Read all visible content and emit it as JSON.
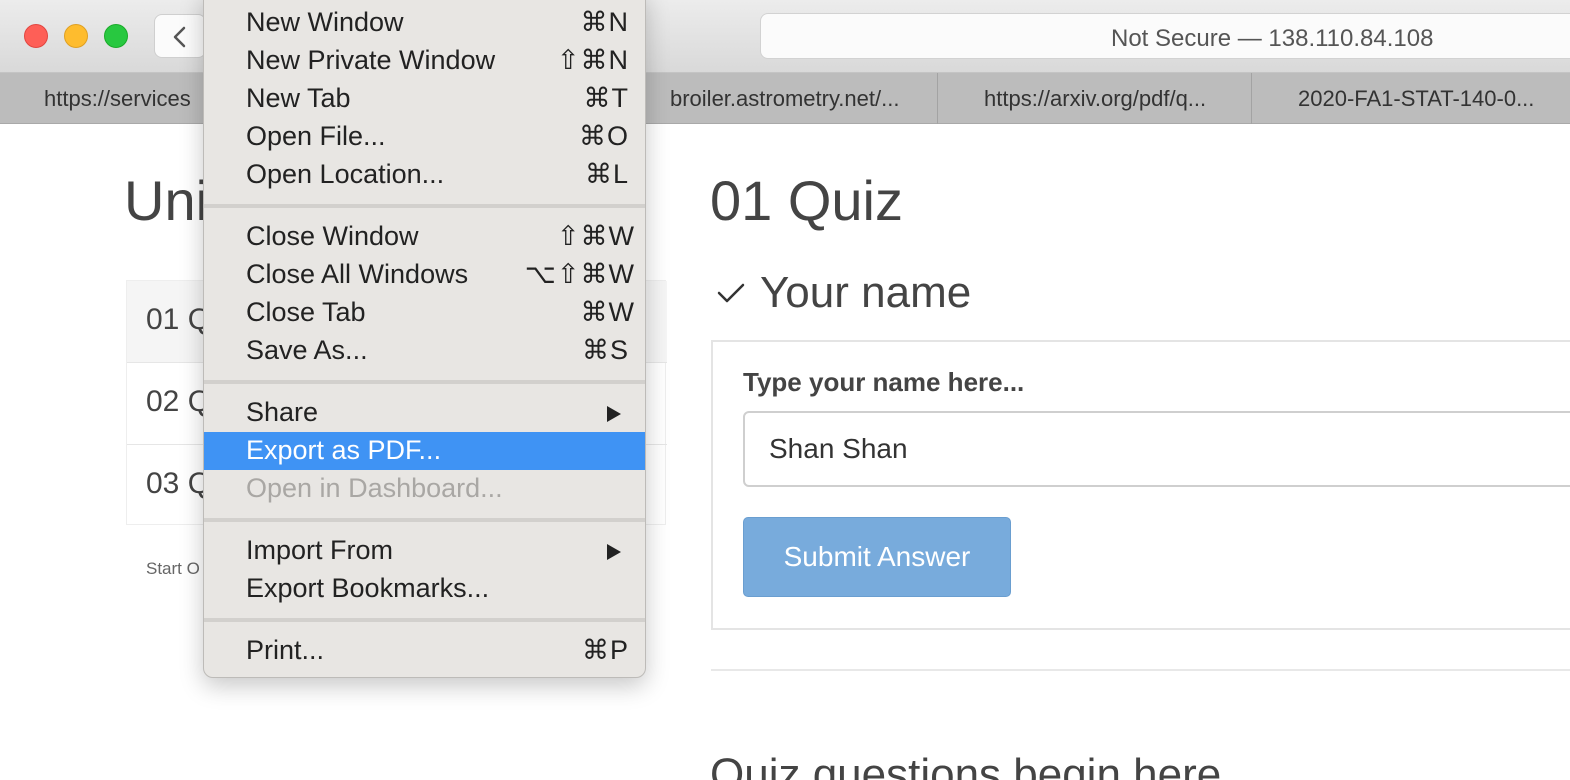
{
  "browser": {
    "address_text": "Not Secure — 138.110.84.108",
    "tabs": [
      "https://services",
      "broiler.astrometry.net/...",
      "https://arxiv.org/pdf/q...",
      "2020-FA1-STAT-140-0..."
    ]
  },
  "left_panel": {
    "title": "Uni",
    "items": [
      "01 Q",
      "02 Q",
      "03 Q"
    ],
    "start_over": "Start O"
  },
  "main": {
    "quiz_title": "01 Quiz",
    "section_title": "Your name",
    "field_label": "Type your name here...",
    "name_value": "Shan Shan",
    "submit_label": "Submit Answer",
    "questions_heading": "Quiz questions begin here"
  },
  "menu": {
    "groups": [
      [
        {
          "label": "New Window",
          "shortcut": "⌘N"
        },
        {
          "label": "New Private Window",
          "shortcut": "⇧⌘N"
        },
        {
          "label": "New Tab",
          "shortcut": "⌘T"
        },
        {
          "label": "Open File...",
          "shortcut": "⌘O"
        },
        {
          "label": "Open Location...",
          "shortcut": "⌘L"
        }
      ],
      [
        {
          "label": "Close Window",
          "shortcut": "⇧⌘W"
        },
        {
          "label": "Close All Windows",
          "shortcut": "⌥⇧⌘W"
        },
        {
          "label": "Close Tab",
          "shortcut": "⌘W"
        },
        {
          "label": "Save As...",
          "shortcut": "⌘S"
        }
      ],
      [
        {
          "label": "Share",
          "submenu": true
        },
        {
          "label": "Export as PDF...",
          "highlighted": true
        },
        {
          "label": "Open in Dashboard...",
          "disabled": true
        }
      ],
      [
        {
          "label": "Import From",
          "submenu": true
        },
        {
          "label": "Export Bookmarks..."
        }
      ],
      [
        {
          "label": "Print...",
          "shortcut": "⌘P"
        }
      ]
    ]
  },
  "colors": {
    "menu_highlight": "#3f93f4",
    "submit_button": "#78abdc"
  }
}
